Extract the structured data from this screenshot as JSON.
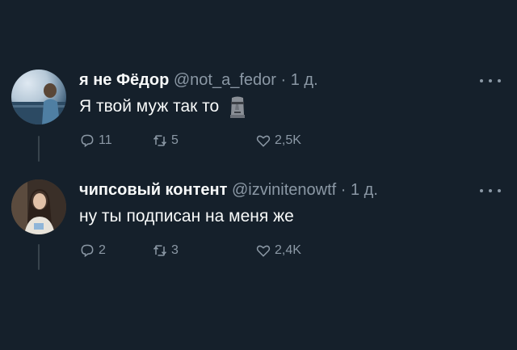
{
  "tweets": [
    {
      "name": "я не Фёдор",
      "handle": "@not_a_fedor",
      "separator": "·",
      "time": "1 д.",
      "text": "Я твой муж так то",
      "emoji": "moai",
      "replies": "11",
      "retweets": "5",
      "likes": "2,5K"
    },
    {
      "name": "чипсовый контент",
      "handle": "@izvinitenowtf",
      "separator": "·",
      "time": "1 д.",
      "text": "ну ты подписан на меня же",
      "replies": "2",
      "retweets": "3",
      "likes": "2,4K"
    }
  ],
  "colors": {
    "background": "#15202b",
    "text_primary": "#f7f9f9",
    "text_secondary": "#8b98a5",
    "thread_line": "#38444d"
  }
}
